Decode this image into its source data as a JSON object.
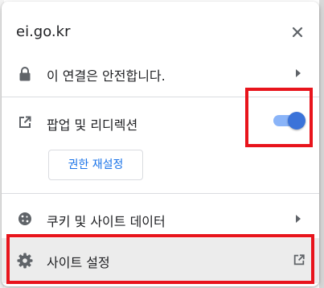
{
  "popup": {
    "domain": "ei.go.kr",
    "close_icon": "close-icon"
  },
  "connection": {
    "label": "이 연결은 안전합니다.",
    "icon": "lock-icon"
  },
  "popups_redirects": {
    "label": "팝업 및 리디렉션",
    "icon": "open-external-icon",
    "enabled": true,
    "reset_button": "권한 재설정"
  },
  "cookies": {
    "label": "쿠키 및 사이트 데이터",
    "icon": "cookie-icon"
  },
  "site_settings": {
    "label": "사이트 설정",
    "icon": "gear-icon",
    "trailing_icon": "open-external-icon"
  },
  "colors": {
    "accent": "#1a73e8",
    "toggle_knob": "#3b73d9",
    "toggle_track": "#8ab4f8",
    "highlight": "#e8141c"
  }
}
